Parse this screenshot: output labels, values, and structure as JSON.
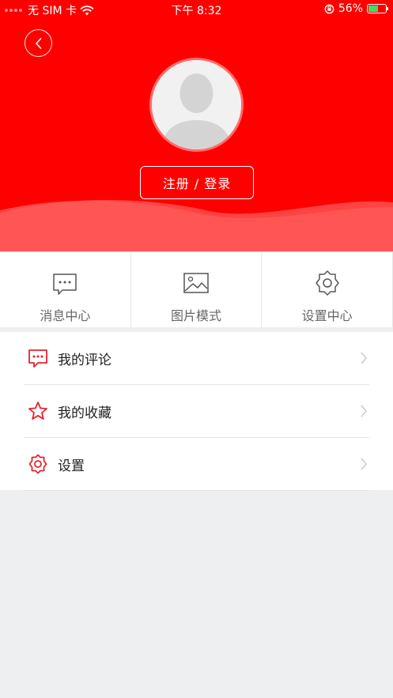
{
  "status_bar": {
    "carrier": "无 SIM 卡",
    "time": "下午 8:32",
    "battery": "56%"
  },
  "profile": {
    "login_label": "注册 / 登录"
  },
  "quick_actions": [
    {
      "label": "消息中心",
      "icon": "message-icon"
    },
    {
      "label": "图片模式",
      "icon": "image-icon"
    },
    {
      "label": "设置中心",
      "icon": "gear-icon"
    }
  ],
  "menu": [
    {
      "label": "我的评论",
      "icon": "comment-icon"
    },
    {
      "label": "我的收藏",
      "icon": "star-icon"
    },
    {
      "label": "设置",
      "icon": "gear-icon"
    }
  ],
  "colors": {
    "brand_red": "#ff0000",
    "icon_red": "#e8232e",
    "page_bg": "#eeeff1"
  }
}
